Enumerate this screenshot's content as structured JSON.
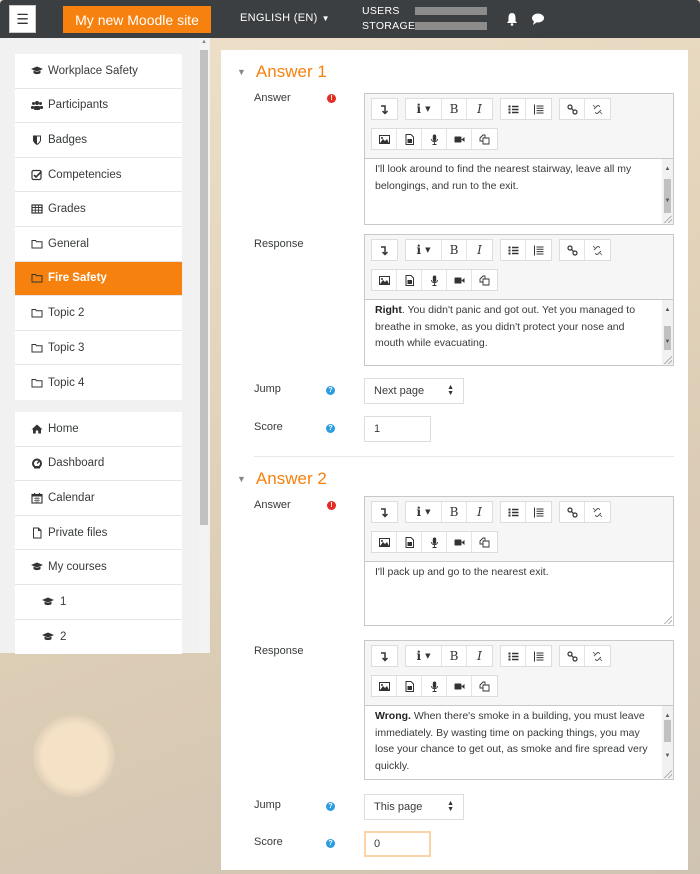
{
  "topbar": {
    "menu_icon": "hamburger-icon",
    "site_name": "My new Moodle site",
    "language": "ENGLISH (EN)",
    "usage": [
      {
        "label": "USERS"
      },
      {
        "label": "STORAGE"
      }
    ],
    "icons": [
      "bell-icon",
      "chat-icon"
    ]
  },
  "sidebar": {
    "course_nav": [
      {
        "label": "Workplace Safety",
        "icon": "graduation-cap-icon"
      },
      {
        "label": "Participants",
        "icon": "users-icon"
      },
      {
        "label": "Badges",
        "icon": "shield-icon"
      },
      {
        "label": "Competencies",
        "icon": "check-square-icon"
      },
      {
        "label": "Grades",
        "icon": "table-icon"
      },
      {
        "label": "General",
        "icon": "folder-icon"
      },
      {
        "label": "Fire Safety",
        "icon": "folder-icon",
        "active": true
      },
      {
        "label": "Topic 2",
        "icon": "folder-icon"
      },
      {
        "label": "Topic 3",
        "icon": "folder-icon"
      },
      {
        "label": "Topic 4",
        "icon": "folder-icon"
      }
    ],
    "site_nav": [
      {
        "label": "Home",
        "icon": "home-icon"
      },
      {
        "label": "Dashboard",
        "icon": "dashboard-icon"
      },
      {
        "label": "Calendar",
        "icon": "calendar-icon"
      },
      {
        "label": "Private files",
        "icon": "file-icon"
      },
      {
        "label": "My courses",
        "icon": "graduation-cap-icon"
      },
      {
        "label": "1",
        "icon": "graduation-cap-icon",
        "sub": true
      },
      {
        "label": "2",
        "icon": "graduation-cap-icon",
        "sub": true
      }
    ]
  },
  "editor_toolbar": {
    "row1": [
      [
        "collapse-toolbar"
      ],
      [
        "paragraph-styles",
        "bold",
        "italic"
      ],
      [
        "unordered-list",
        "ordered-list"
      ],
      [
        "link",
        "unlink"
      ]
    ],
    "row2": [
      "insert-image",
      "insert-media",
      "record-audio",
      "record-video",
      "manage-files"
    ]
  },
  "answers": [
    {
      "title": "Answer 1",
      "answer_label": "Answer",
      "answer_text": "I'll look around to find the nearest stairway, leave all my belongings, and run to the exit.",
      "response_label": "Response",
      "response_bold": "Right",
      "response_text": ". You didn't panic and got out. Yet you managed to breathe in smoke, as you didn't protect your nose and mouth while evacuating.",
      "jump_label": "Jump",
      "jump_value": "Next page",
      "score_label": "Score",
      "score_value": "1"
    },
    {
      "title": "Answer 2",
      "answer_label": "Answer",
      "answer_text": "I'll pack up and go to the nearest exit.",
      "response_label": "Response",
      "response_bold": "Wrong.",
      "response_text": " When there's smoke in a building, you must leave immediately. By wasting time on packing things, you may lose your chance to get out, as smoke and fire spread very quickly.",
      "jump_label": "Jump",
      "jump_value": "This page",
      "score_label": "Score",
      "score_value": "0"
    }
  ],
  "colors": {
    "brand": "#f7810e",
    "topbar": "#3c3f41",
    "required": "#e32d22",
    "help": "#2c9de0"
  }
}
